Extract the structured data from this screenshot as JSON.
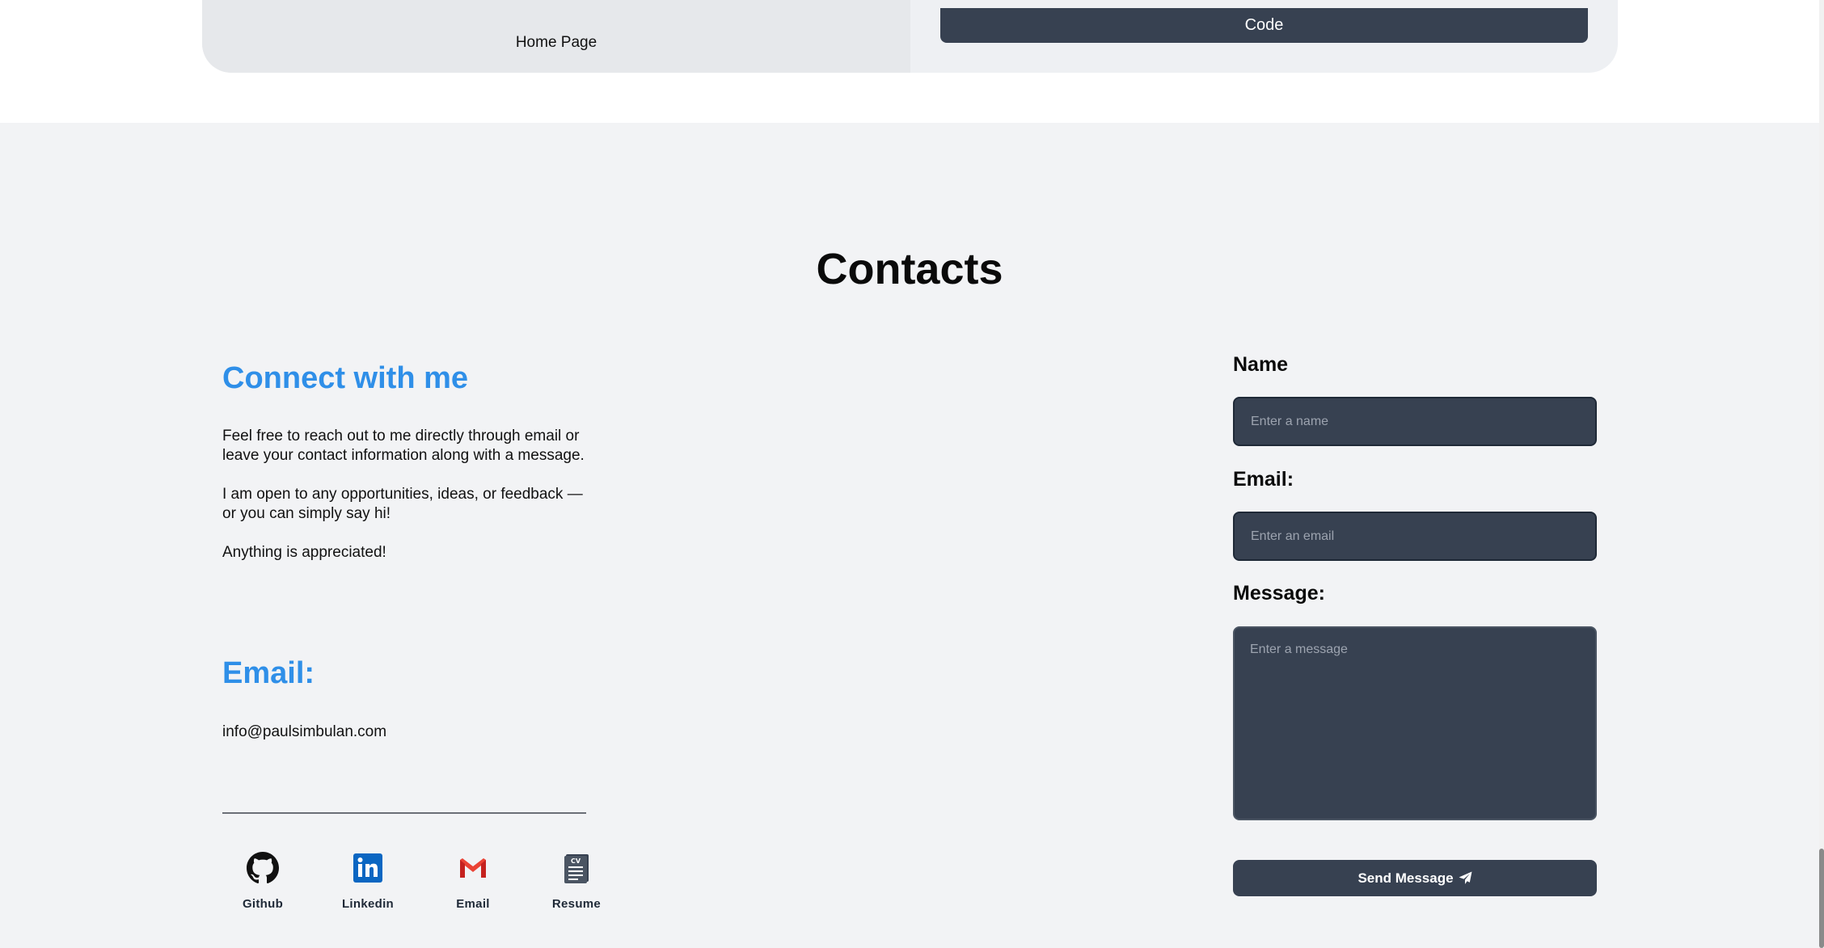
{
  "project_card": {
    "left_label": "Home Page",
    "code_button": "Code"
  },
  "contacts": {
    "title": "Contacts",
    "connect_title": "Connect with me",
    "paragraphs": [
      "Feel free to reach out to me directly through email or leave your contact information along with a message.",
      "I am open to any opportunities, ideas, or feedback — or you can simply say hi!",
      "Anything is appreciated!"
    ],
    "email_title": "Email:",
    "email_address": "info@paulsimbulan.com",
    "socials": [
      {
        "label": "Github",
        "icon": "github-icon"
      },
      {
        "label": "Linkedin",
        "icon": "linkedin-icon"
      },
      {
        "label": "Email",
        "icon": "gmail-icon"
      },
      {
        "label": "Resume",
        "icon": "cv-icon"
      }
    ]
  },
  "form": {
    "name_label": "Name",
    "name_placeholder": "Enter a name",
    "email_label": "Email:",
    "email_placeholder": "Enter an email",
    "message_label": "Message:",
    "message_placeholder": "Enter a message",
    "send_button": "Send Message"
  },
  "colors": {
    "accent": "#2f8fe8",
    "dark": "#374151",
    "section_bg": "#f2f3f5",
    "linkedin": "#0a66c2",
    "gmail_red": "#ea4335"
  }
}
